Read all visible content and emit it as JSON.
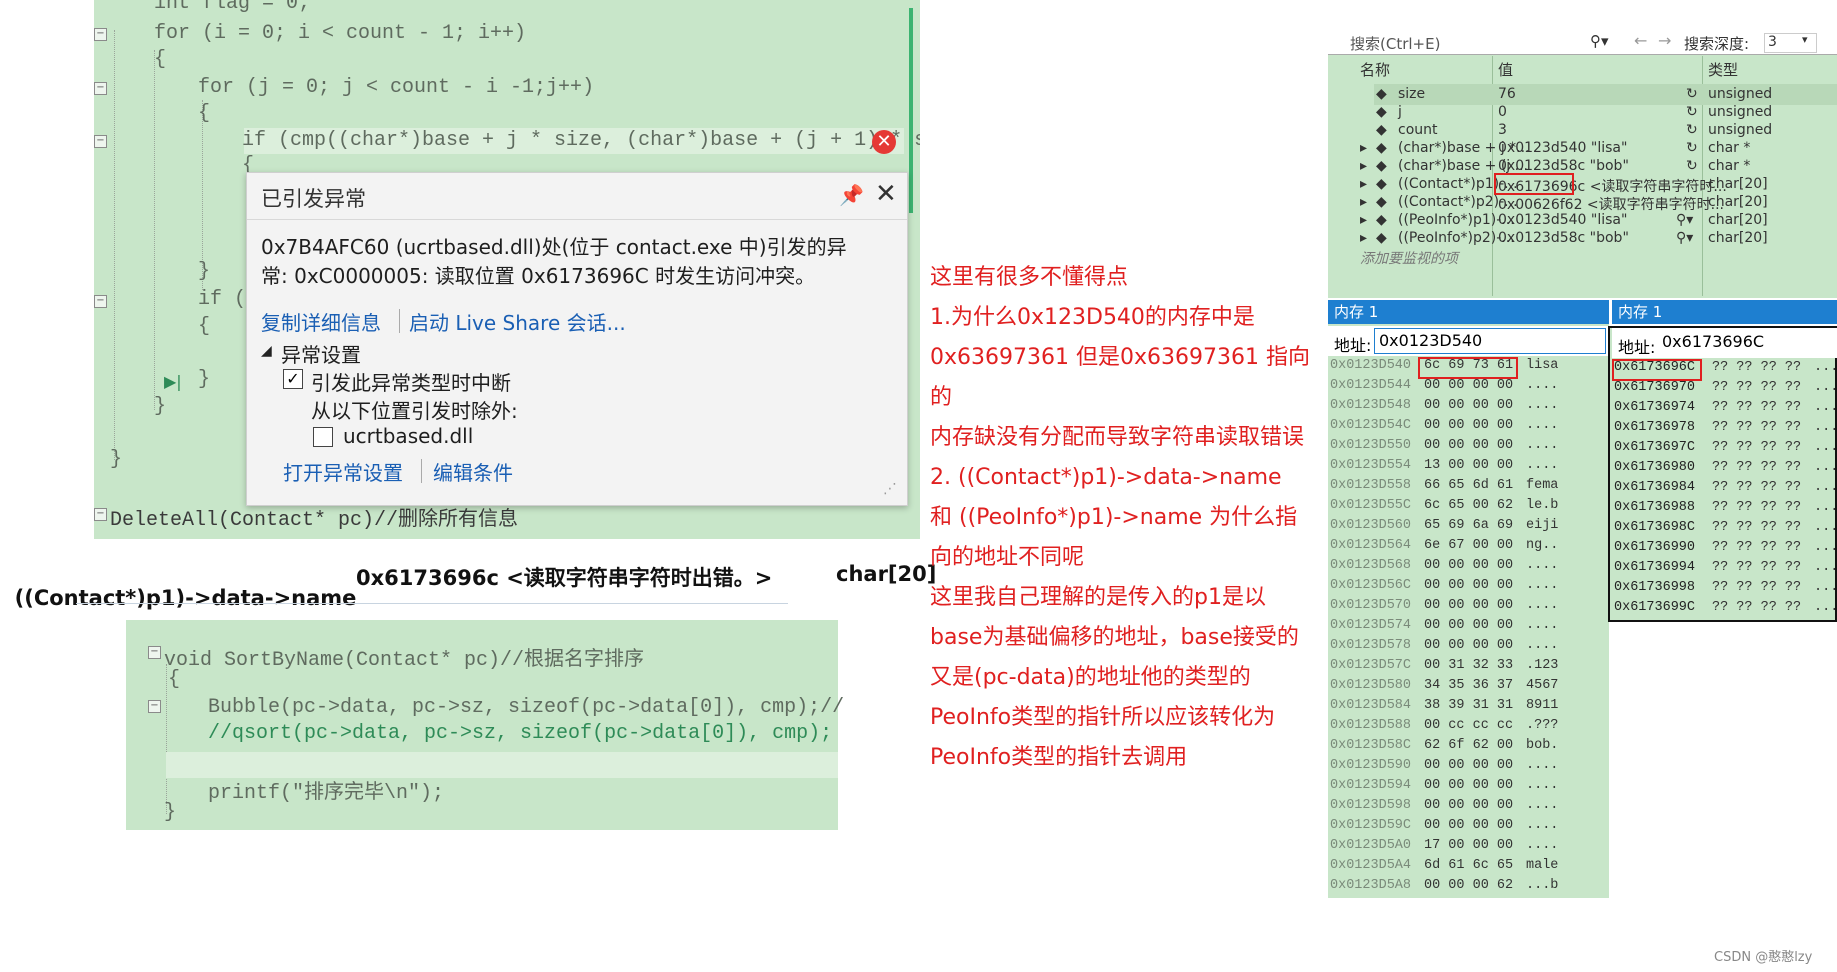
{
  "editor1": {
    "lines": [
      {
        "text": "int flag = 0;"
      },
      {
        "text": "for (i = 0; i < count - 1; i++)"
      },
      {
        "text": "{"
      },
      {
        "text": "for (j = 0; j < count - i -1;j++)"
      },
      {
        "text": "{"
      },
      {
        "text": "if (cmp((char*)base + j * size, (char*)base + (j + 1) * si"
      },
      {
        "text": "{"
      },
      {
        "text": "}"
      },
      {
        "text": "if ("
      },
      {
        "text": "{"
      },
      {
        "text": "}"
      },
      {
        "text": "}"
      },
      {
        "text": "}"
      },
      {
        "text": "DeleteAll(Contact* pc)//删除所有信息"
      }
    ]
  },
  "exception": {
    "title": "已引发异常",
    "message": "0x7B4AFC60 (ucrtbased.dll)处(位于 contact.exe 中)引发的异常: 0xC0000005: 读取位置 0x6173696C 时发生访问冲突。",
    "link_copy": "复制详细信息",
    "link_liveshare": "启动 Live Share 会话...",
    "settings_header": "异常设置",
    "break_label": "引发此异常类型时中断",
    "except_label": "从以下位置引发时除外:",
    "module_label": "ucrtbased.dll",
    "link_open": "打开异常设置",
    "link_edit": "编辑条件"
  },
  "callout": {
    "name": "((Contact*)p1)->data->name",
    "value": "0x6173696c <读取字符串字符时出错。>",
    "type": "char[20]"
  },
  "editor2": {
    "line1": "void SortByName(Contact* pc)//根据名字排序",
    "line2": "{",
    "line3": "Bubble(pc->data, pc->sz, sizeof(pc->data[0]), cmp);//",
    "line4": "//qsort(pc->data, pc->sz, sizeof(pc->data[0]), cmp);",
    "line5": "printf(\"排序完毕\\n\");",
    "line6": "}"
  },
  "note": {
    "lines": [
      "这里有很多不懂得点",
      "1.为什么0x123D540的内存中是",
      "0x63697361  但是0x63697361 指向的",
      "内存缺没有分配而导致字符串读取错误",
      "2.   ((Contact*)p1)->data->name",
      "和 ((PeoInfo*)p1)->name 为什么指",
      "向的地址不同呢",
      "这里我自己理解的是传入的p1是以",
      "base为基础偏移的地址，base接受的",
      "又是(pc-data)的地址他的类型的",
      "PeoInfo类型的指针所以应该转化为",
      "PeoInfo类型的指针去调用"
    ]
  },
  "watch": {
    "search_placeholder": "搜索(Ctrl+E)",
    "depth_label": "搜索深度:",
    "depth_value": "3",
    "col_name": "名称",
    "col_value": "值",
    "col_type": "类型",
    "rows": [
      {
        "name": "size",
        "value": "76",
        "type": "unsigned"
      },
      {
        "name": "j",
        "value": "0",
        "type": "unsigned"
      },
      {
        "name": "count",
        "value": "3",
        "type": "unsigned"
      },
      {
        "name": "(char*)base + j *...",
        "value": "0x0123d540 \"lisa\"",
        "type": "char *"
      },
      {
        "name": "(char*)base + (j ...",
        "value": "0x0123d58c \"bob\"",
        "type": "char *"
      },
      {
        "name": "((Contact*)p1)-...",
        "value": "0x6173696c <读取字符串字符时...",
        "type": "char[20]"
      },
      {
        "name": "((Contact*)p2)-...",
        "value": "0x00626f62 <读取字符串字符时...",
        "type": "char[20]"
      },
      {
        "name": "((PeoInfo*)p1)-...",
        "value": "0x0123d540 \"lisa\"",
        "type": "char[20]"
      },
      {
        "name": "((PeoInfo*)p2)-...",
        "value": "0x0123d58c \"bob\"",
        "type": "char[20]"
      }
    ],
    "add_item": "添加要监视的项"
  },
  "memory1": {
    "title": "内存 1",
    "addr_label": "地址:",
    "addr_value": "0x0123D540",
    "rows": [
      {
        "addr": "0x0123D540",
        "bytes": "6c 69 73 61",
        "ascii": "lisa"
      },
      {
        "addr": "0x0123D544",
        "bytes": "00 00 00 00",
        "ascii": "...."
      },
      {
        "addr": "0x0123D548",
        "bytes": "00 00 00 00",
        "ascii": "...."
      },
      {
        "addr": "0x0123D54C",
        "bytes": "00 00 00 00",
        "ascii": "...."
      },
      {
        "addr": "0x0123D550",
        "bytes": "00 00 00 00",
        "ascii": "...."
      },
      {
        "addr": "0x0123D554",
        "bytes": "13 00 00 00",
        "ascii": "...."
      },
      {
        "addr": "0x0123D558",
        "bytes": "66 65 6d 61",
        "ascii": "fema"
      },
      {
        "addr": "0x0123D55C",
        "bytes": "6c 65 00 62",
        "ascii": "le.b"
      },
      {
        "addr": "0x0123D560",
        "bytes": "65 69 6a 69",
        "ascii": "eiji"
      },
      {
        "addr": "0x0123D564",
        "bytes": "6e 67 00 00",
        "ascii": "ng.."
      },
      {
        "addr": "0x0123D568",
        "bytes": "00 00 00 00",
        "ascii": "...."
      },
      {
        "addr": "0x0123D56C",
        "bytes": "00 00 00 00",
        "ascii": "...."
      },
      {
        "addr": "0x0123D570",
        "bytes": "00 00 00 00",
        "ascii": "...."
      },
      {
        "addr": "0x0123D574",
        "bytes": "00 00 00 00",
        "ascii": "...."
      },
      {
        "addr": "0x0123D578",
        "bytes": "00 00 00 00",
        "ascii": "...."
      },
      {
        "addr": "0x0123D57C",
        "bytes": "00 31 32 33",
        "ascii": ".123"
      },
      {
        "addr": "0x0123D580",
        "bytes": "34 35 36 37",
        "ascii": "4567"
      },
      {
        "addr": "0x0123D584",
        "bytes": "38 39 31 31",
        "ascii": "8911"
      },
      {
        "addr": "0x0123D588",
        "bytes": "00 cc cc cc",
        "ascii": ".???"
      },
      {
        "addr": "0x0123D58C",
        "bytes": "62 6f 62 00",
        "ascii": "bob."
      },
      {
        "addr": "0x0123D590",
        "bytes": "00 00 00 00",
        "ascii": "...."
      },
      {
        "addr": "0x0123D594",
        "bytes": "00 00 00 00",
        "ascii": "...."
      },
      {
        "addr": "0x0123D598",
        "bytes": "00 00 00 00",
        "ascii": "...."
      },
      {
        "addr": "0x0123D59C",
        "bytes": "00 00 00 00",
        "ascii": "...."
      },
      {
        "addr": "0x0123D5A0",
        "bytes": "17 00 00 00",
        "ascii": "...."
      },
      {
        "addr": "0x0123D5A4",
        "bytes": "6d 61 6c 65",
        "ascii": "male"
      },
      {
        "addr": "0x0123D5A8",
        "bytes": "00 00 00 62",
        "ascii": "...b"
      }
    ]
  },
  "memory2": {
    "title": "内存 1",
    "addr_label": "地址:",
    "addr_value": "0x6173696C",
    "rows": [
      {
        "addr": "0x6173696C",
        "bytes": "?? ?? ?? ??",
        "ascii": "..."
      },
      {
        "addr": "0x61736970",
        "bytes": "?? ?? ?? ??",
        "ascii": "..."
      },
      {
        "addr": "0x61736974",
        "bytes": "?? ?? ?? ??",
        "ascii": "..."
      },
      {
        "addr": "0x61736978",
        "bytes": "?? ?? ?? ??",
        "ascii": "..."
      },
      {
        "addr": "0x6173697C",
        "bytes": "?? ?? ?? ??",
        "ascii": "..."
      },
      {
        "addr": "0x61736980",
        "bytes": "?? ?? ?? ??",
        "ascii": "..."
      },
      {
        "addr": "0x61736984",
        "bytes": "?? ?? ?? ??",
        "ascii": "..."
      },
      {
        "addr": "0x61736988",
        "bytes": "?? ?? ?? ??",
        "ascii": "..."
      },
      {
        "addr": "0x6173698C",
        "bytes": "?? ?? ?? ??",
        "ascii": "..."
      },
      {
        "addr": "0x61736990",
        "bytes": "?? ?? ?? ??",
        "ascii": "..."
      },
      {
        "addr": "0x61736994",
        "bytes": "?? ?? ?? ??",
        "ascii": "..."
      },
      {
        "addr": "0x61736998",
        "bytes": "?? ?? ?? ??",
        "ascii": "..."
      },
      {
        "addr": "0x6173699C",
        "bytes": "?? ?? ?? ??",
        "ascii": "..."
      }
    ]
  },
  "watermark": "CSDN @憨憨lzy",
  "colors": {
    "editor_bg": "#c8e6c9",
    "accent": "#1e7fd0",
    "annotation": "#e02020"
  }
}
